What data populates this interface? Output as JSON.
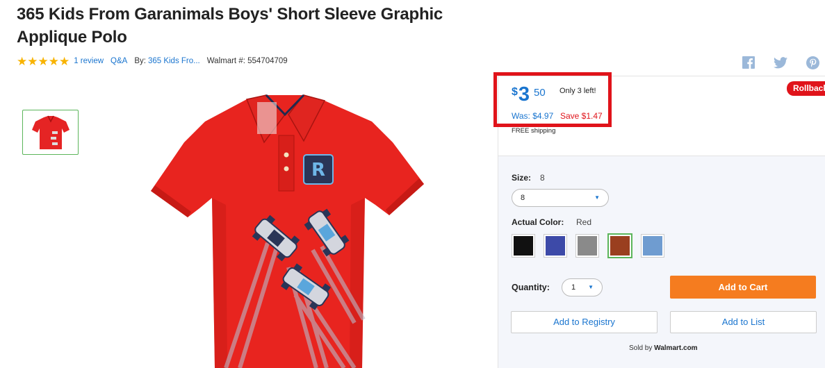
{
  "product": {
    "title": "365 Kids From Garanimals Boys' Short Sleeve Graphic Applique Polo",
    "stars": "★★★★★",
    "reviews_link": "1 review",
    "qa_link": "Q&A",
    "by_label": "By:",
    "brand_link": "365 Kids Fro...",
    "walmart_number": "Walmart #: 554704709",
    "rating": 5
  },
  "social": {
    "icons": [
      "facebook-icon",
      "twitter-icon",
      "pinterest-icon"
    ],
    "color": "#9bb8d9"
  },
  "price": {
    "currency": "$",
    "dollars": "3",
    "cents": "50",
    "stock": "Only 3 left!",
    "was": "Was: $4.97",
    "save": "Save $1.47",
    "shipping": "FREE shipping",
    "badge": "Rollback"
  },
  "options": {
    "size_label": "Size:",
    "size_value": "8",
    "size_selected": "8",
    "color_label": "Actual Color:",
    "color_value": "Red",
    "swatches": [
      "#111111",
      "#3d4aa8",
      "#8a8a8a",
      "#9a3f1f",
      "#6f9cd0"
    ],
    "selected_swatch": 3,
    "quantity_label": "Quantity:",
    "quantity_value": "1"
  },
  "actions": {
    "add_to_cart": "Add to Cart",
    "add_to_registry": "Add to Registry",
    "add_to_list": "Add to List",
    "sold_by_prefix": "Sold by",
    "sold_by_seller": "Walmart.com"
  },
  "colors": {
    "accent_blue": "#1a75cf",
    "sale_red": "#e0131a",
    "cart_orange": "#f57c1f",
    "star": "#f8b300"
  }
}
